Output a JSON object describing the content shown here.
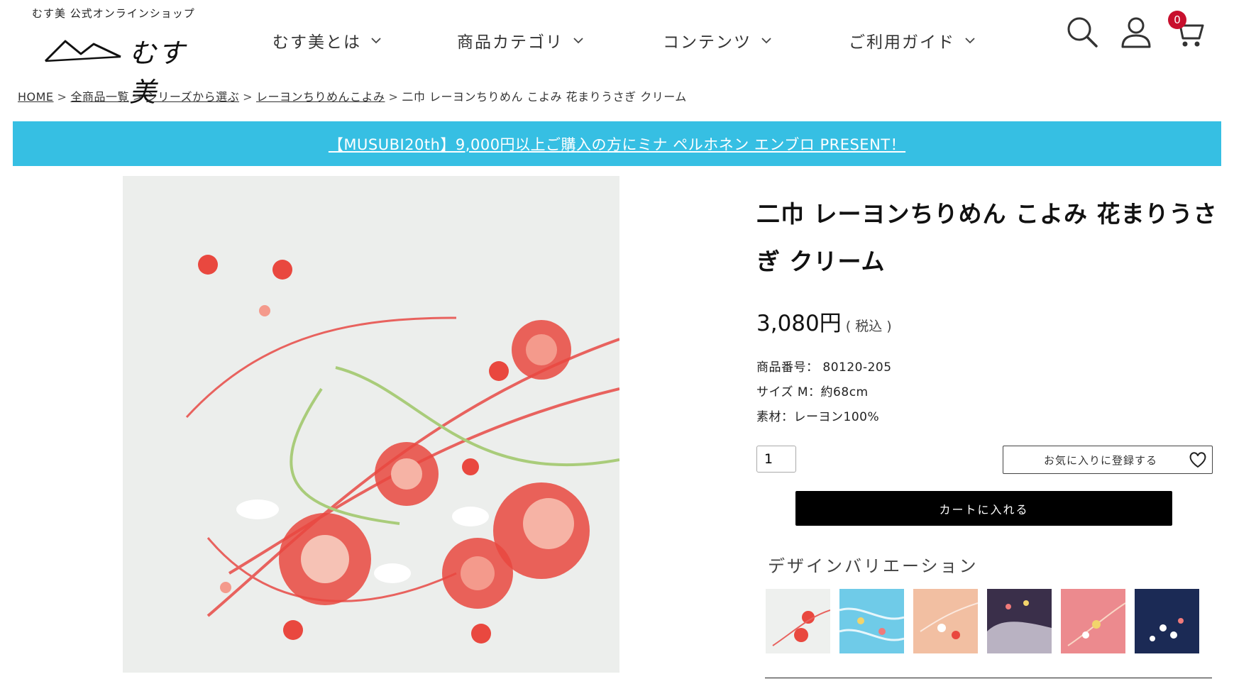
{
  "header": {
    "tagline": "むす美 公式オンラインショップ",
    "logo_text": "むす美",
    "nav": [
      {
        "label": "むす美とは",
        "icon": "chevron-down-icon"
      },
      {
        "label": "商品カテゴリ",
        "icon": "chevron-down-icon"
      },
      {
        "label": "コンテンツ",
        "icon": "chevron-down-icon"
      },
      {
        "label": "ご利用ガイド",
        "icon": "chevron-down-icon"
      }
    ],
    "icons": [
      "search-icon",
      "user-icon",
      "cart-icon"
    ],
    "cart_count": "0",
    "badge_color": "#c8102e"
  },
  "breadcrumb": {
    "items": [
      "HOME",
      "全商品一覧",
      "シリーズから選ぶ",
      "レーヨンちりめんこよみ"
    ],
    "separator": ">",
    "current": "二巾 レーヨンちりめん こよみ 花まりうさぎ クリーム"
  },
  "banner": {
    "text": "【MUSUBI20th】9,000円以上ご購入の方にミナ ペルホネン エンブロ PRESENT！",
    "color": "#36bfe3"
  },
  "product": {
    "title": "二巾 レーヨンちりめん こよみ 花まりうさぎ クリーム",
    "price": "3,080円",
    "tax_note": "( 税込 )",
    "item_number": "商品番号： 80120-205",
    "size": "サイズ M：約68cm",
    "material": "素材：レーヨン100%",
    "quantity": "1",
    "favorite_label": "お気に入りに登録する",
    "cart_label": "カートに入れる"
  },
  "variations": {
    "heading": "デザインバリエーション",
    "swatch_colors": [
      "#eef0ee",
      "#6fcbe8",
      "#f2bfa2",
      "#3a2f4a",
      "#ec8a8e",
      "#1b2a55"
    ]
  }
}
